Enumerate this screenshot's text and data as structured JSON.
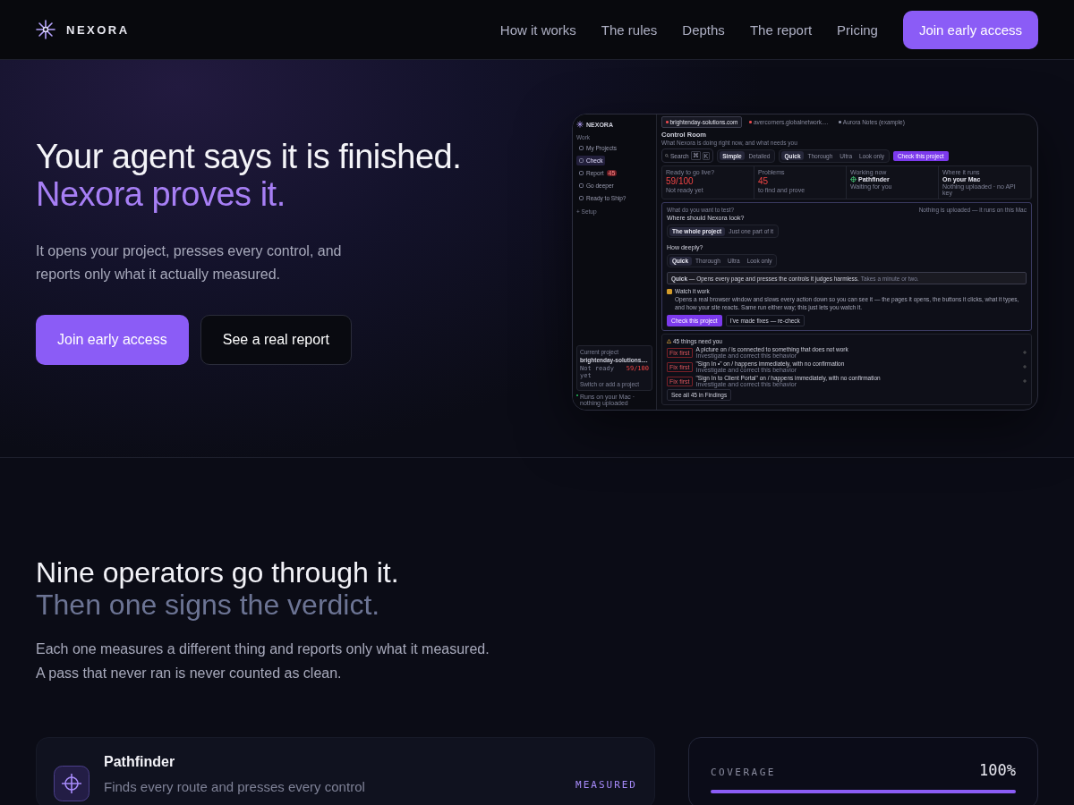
{
  "nav": {
    "brand": "NEXORA",
    "links": [
      "How it works",
      "The rules",
      "Depths",
      "The report",
      "Pricing"
    ],
    "cta": "Join early access"
  },
  "hero": {
    "title": "Your agent says it is finished.",
    "title_accent": "Nexora proves it.",
    "text": "It opens your project, presses every control, and reports only what it actually measured.",
    "primary": "Join early access",
    "secondary": "See a real report"
  },
  "app": {
    "sidebar": {
      "brand": "NEXORA",
      "section": "Work",
      "items": [
        {
          "label": "My Projects",
          "selected": false
        },
        {
          "label": "Check",
          "selected": true
        },
        {
          "label": "Report",
          "selected": false,
          "badge": "45"
        },
        {
          "label": "Go deeper",
          "selected": false
        },
        {
          "label": "Ready to Ship?",
          "selected": false
        }
      ],
      "setup": "+ Setup",
      "project": {
        "label": "Current project",
        "name": "brightenday-solutions....",
        "status": "Not ready yet",
        "score": "59/100",
        "switch": "Switch or add a project"
      },
      "footer": "Runs on your Mac · nothing uploaded"
    },
    "tabs": [
      {
        "label": "brightenday-solutions.com",
        "selected": true,
        "color": "#e5484d"
      },
      {
        "label": "avercorners.globalnetwork....",
        "selected": false,
        "color": "#e5484d"
      },
      {
        "label": "Aurora Notes (example)",
        "selected": false,
        "color": "#8a8fa3"
      }
    ],
    "header": {
      "title": "Control Room",
      "subtitle": "What Nexora is doing right now, and what needs you",
      "search": "Search",
      "keys": [
        "⌘",
        "K"
      ],
      "modes": [
        {
          "label": "Simple",
          "selected": true
        },
        {
          "label": "Detailed",
          "selected": false
        }
      ],
      "depths": [
        {
          "label": "Quick",
          "selected": true
        },
        {
          "label": "Thorough",
          "selected": false
        },
        {
          "label": "Ultra",
          "selected": false
        },
        {
          "label": "Look only",
          "selected": false
        }
      ],
      "cta": "Check this project"
    },
    "stats": [
      {
        "label": "Ready to go live?",
        "value": "59/100",
        "note": "Not ready yet",
        "kind": "alert"
      },
      {
        "label": "Problems",
        "value": "45",
        "note": "to find and prove",
        "kind": "alert"
      },
      {
        "label": "Working now",
        "value": "Pathfinder",
        "note": "Waiting for you",
        "kind": "agent"
      },
      {
        "label": "Where it runs",
        "value": "On your Mac",
        "note": "Nothing uploaded · no API key",
        "kind": "plain"
      }
    ],
    "check": {
      "question": "What do you want to test?",
      "note": "Nothing is uploaded — it runs on this Mac",
      "where": "Where should Nexora look?",
      "scopes": [
        {
          "label": "The whole project",
          "selected": true
        },
        {
          "label": "Just one part of it",
          "selected": false
        }
      ],
      "depth_label": "How deeply?",
      "depths": [
        {
          "label": "Quick",
          "selected": true
        },
        {
          "label": "Thorough",
          "selected": false
        },
        {
          "label": "Ultra",
          "selected": false
        },
        {
          "label": "Look only",
          "selected": false
        }
      ],
      "info": "**Quick** — Opens every page and presses the controls it judges harmless.",
      "info_note": "Takes a minute or two.",
      "watch": {
        "label": "Watch it work",
        "checked": true,
        "text": "Opens a real browser window and slows every action down so you can see it — the pages it opens, the buttons it clicks, what it types, and how your site reacts. Same run either way; this just lets you watch it."
      },
      "run": "Check this project",
      "recheck": "I've made fixes — re-check"
    },
    "findings": {
      "title": "45 things need you",
      "items": [
        {
          "tag": "Fix first",
          "title": "A picture on / is connected to something that does not work",
          "sub": "Investigate and correct this behavior"
        },
        {
          "tag": "Fix first",
          "title": "\"Sign In •\" on / happens immediately, with no confirmation",
          "sub": "Investigate and correct this behavior"
        },
        {
          "tag": "Fix first",
          "title": "\"Sign In to Client Portal\" on / happens immediately, with no confirmation",
          "sub": "Investigate and correct this behavior"
        }
      ],
      "more": "See all 45 in Findings"
    }
  },
  "operators": {
    "title": "Nine operators go through it.",
    "title_dim": "Then one signs the verdict.",
    "lines": [
      "Each one measures a different thing and reports only what it measured.",
      "A pass that never ran is never counted as clean."
    ],
    "card": {
      "name": "Pathfinder",
      "text": "Finds every route and presses every control",
      "status": "MEASURED"
    },
    "coverage": {
      "label": "COVERAGE",
      "value": "100%",
      "level": 1
    }
  }
}
